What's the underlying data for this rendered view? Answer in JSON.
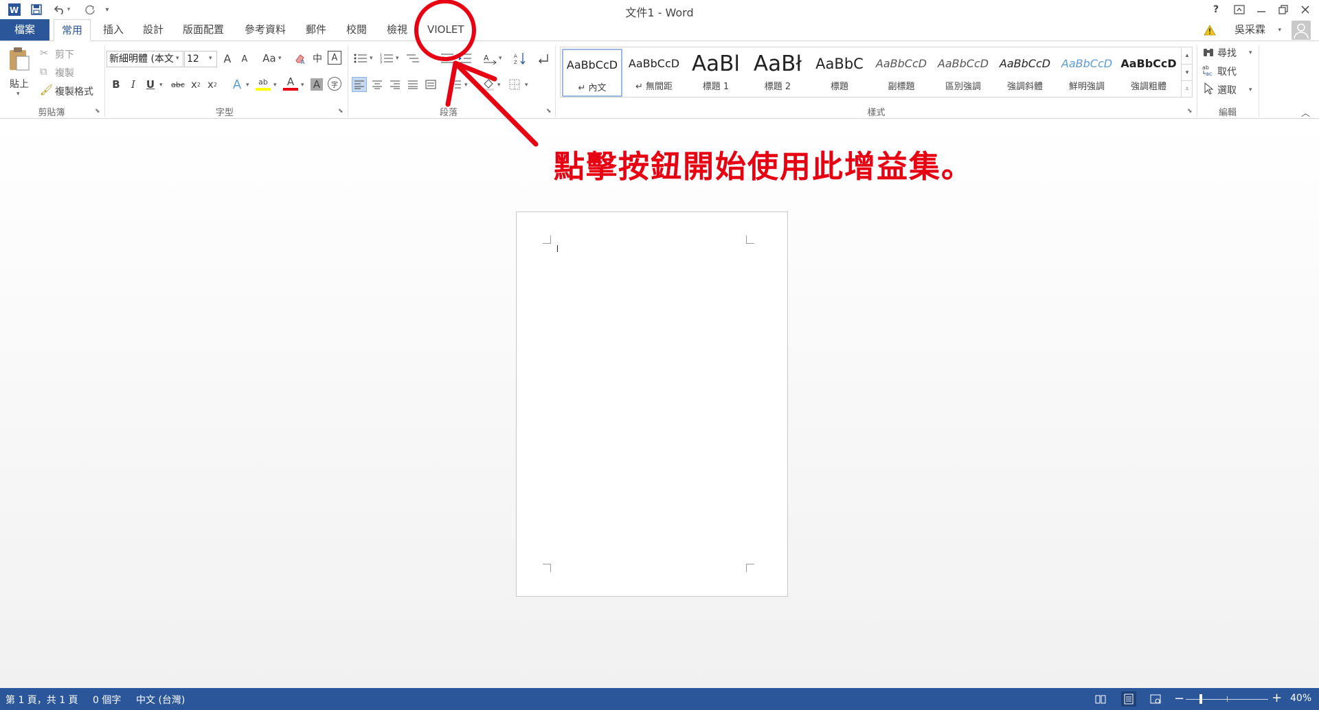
{
  "window": {
    "title": "文件1 - Word",
    "help": "?",
    "user": "吳采霖"
  },
  "qat": {
    "word_icon": "word-logo-icon",
    "save_icon": "save-icon",
    "undo_icon": "undo-icon",
    "redo_icon": "redo-icon",
    "customize": "▾"
  },
  "tabs": [
    {
      "label": "檔案"
    },
    {
      "label": "常用"
    },
    {
      "label": "插入"
    },
    {
      "label": "設計"
    },
    {
      "label": "版面配置"
    },
    {
      "label": "參考資料"
    },
    {
      "label": "郵件"
    },
    {
      "label": "校閱"
    },
    {
      "label": "檢視"
    },
    {
      "label": "VIOLET"
    }
  ],
  "clipboard": {
    "paste": "貼上",
    "cut": "剪下",
    "copy": "複製",
    "format_painter": "複製格式",
    "group": "剪貼簿"
  },
  "font": {
    "name": "新細明體 (本文",
    "size": "12",
    "group": "字型",
    "change_case": "Aa",
    "phonetic": "中",
    "grow": "A",
    "shrink": "A",
    "bold": "B",
    "italic": "I",
    "underline": "U",
    "strike": "abc",
    "sub": "x",
    "sup": "x",
    "text_effect": "A",
    "highlight": "ab",
    "font_color": "A",
    "char_shade": "A",
    "enclose": "字"
  },
  "paragraph": {
    "group": "段落"
  },
  "styles": {
    "group": "樣式",
    "items": [
      {
        "preview": "AaBbCcD",
        "name": "↵ 內文"
      },
      {
        "preview": "AaBbCcD",
        "name": "↵ 無間距"
      },
      {
        "preview": "AaBl",
        "name": "標題 1"
      },
      {
        "preview": "AaBł",
        "name": "標題 2"
      },
      {
        "preview": "AaBbC",
        "name": "標題"
      },
      {
        "preview": "AaBbCcD",
        "name": "副標題"
      },
      {
        "preview": "AaBbCcD",
        "name": "區別強調"
      },
      {
        "preview": "AaBbCcD",
        "name": "強調斜體"
      },
      {
        "preview": "AaBbCcD",
        "name": "鮮明強調"
      },
      {
        "preview": "AaBbCcD",
        "name": "強調粗體"
      }
    ]
  },
  "editing": {
    "find": "尋找",
    "replace": "取代",
    "select": "選取",
    "group": "編輯"
  },
  "annotation": {
    "text": "點擊按鈕開始使用此增益集。",
    "color": "#e60012"
  },
  "status": {
    "page": "第 1 頁，共 1 頁",
    "words": "0 個字",
    "lang": "中文 (台灣)",
    "zoom": "40%"
  },
  "colors": {
    "accent": "#2b579a"
  }
}
